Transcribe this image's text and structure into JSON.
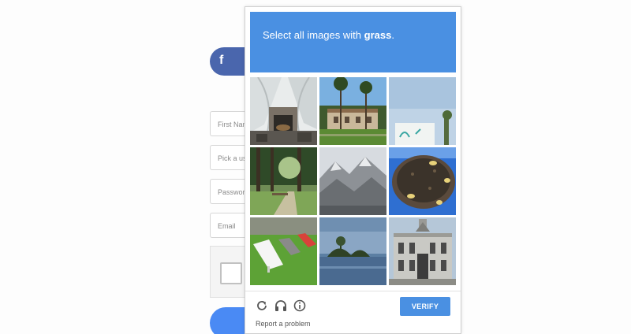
{
  "background_form": {
    "facebook_letter": "f",
    "fields": [
      {
        "placeholder": "First Nan"
      },
      {
        "placeholder": "Pick a us"
      },
      {
        "placeholder": "Passwor"
      },
      {
        "placeholder": "Email"
      }
    ]
  },
  "captcha": {
    "instruction_prefix": "Select all images with ",
    "instruction_target": "grass",
    "instruction_suffix": ".",
    "tiles": [
      {
        "subject": "greenhouse fireplace"
      },
      {
        "subject": "palm trees building"
      },
      {
        "subject": "sign with sky"
      },
      {
        "subject": "grassy forest path"
      },
      {
        "subject": "rocky mountains"
      },
      {
        "subject": "paella pan"
      },
      {
        "subject": "lawn chairs on grass"
      },
      {
        "subject": "island in lake"
      },
      {
        "subject": "historic building"
      }
    ],
    "icons": [
      "reload-icon",
      "headphones-icon",
      "info-icon"
    ],
    "verify_label": "VERIFY",
    "report_label": "Report a problem",
    "colors": {
      "accent": "#4a90e2",
      "facebook": "#4a66ad"
    }
  }
}
